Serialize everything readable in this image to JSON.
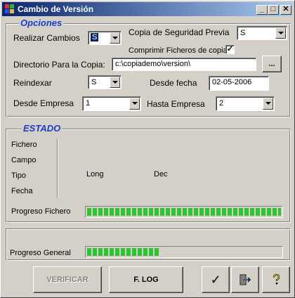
{
  "window": {
    "title": "Cambio de Versión"
  },
  "titlebar_buttons": {
    "minimize": "_",
    "maximize": "□",
    "close": "✕"
  },
  "opciones": {
    "legend": "Opciones",
    "realizar_cambios": {
      "label": "Realizar Cambios",
      "value": "S"
    },
    "copia_seguridad": {
      "label": "Copia de Seguridad Previa",
      "value": "S"
    },
    "comprimir": {
      "label": "Comprimir Ficheros de copia",
      "checked": true,
      "mark": "✓"
    },
    "directorio": {
      "label": "Directorio Para la Copia:",
      "value": "c:\\copiademo\\version\\",
      "browse_label": "..."
    },
    "reindexar": {
      "label": "Reindexar",
      "value": "S"
    },
    "desde_fecha": {
      "label": "Desde fecha",
      "value": "02-05-2006"
    },
    "desde_empresa": {
      "label": "Desde Empresa",
      "value": "1"
    },
    "hasta_empresa": {
      "label": "Hasta Empresa",
      "value": "2"
    }
  },
  "estado": {
    "legend": "ESTADO",
    "fichero_label": "Fichero",
    "campo_label": "Campo",
    "tipo_label": "Tipo",
    "tipo_long": "Long",
    "tipo_dec": "Dec",
    "fecha_label": "Fecha",
    "progreso_fichero": {
      "label": "Progreso Fichero",
      "fraction": 1.0
    }
  },
  "general": {
    "progreso_general": {
      "label": "Progreso General",
      "fraction": 0.37
    }
  },
  "buttons": {
    "verificar": "VERIFICAR",
    "flog": "F. LOG",
    "accept_icon": "✓"
  },
  "colors": {
    "legend_blue": "#1a3cd6",
    "progress_green": "#2fc42f",
    "title_dark": "#0a246a",
    "title_light": "#a6caf0",
    "face": "#d4d0c8"
  }
}
